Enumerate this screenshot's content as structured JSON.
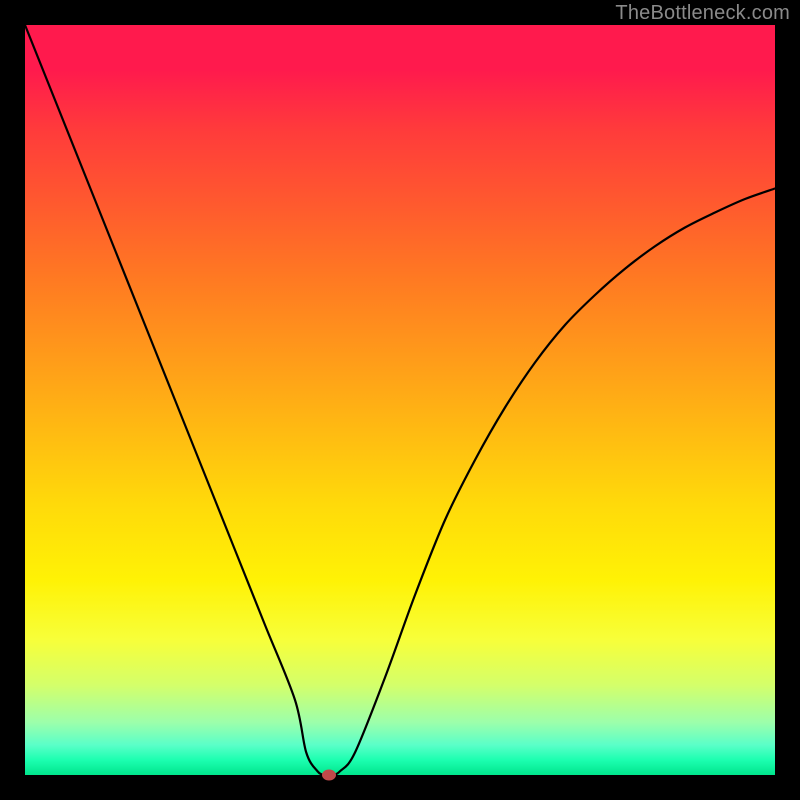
{
  "watermark": "TheBottleneck.com",
  "chart_data": {
    "type": "line",
    "title": "",
    "xlabel": "",
    "ylabel": "",
    "xlim": [
      0,
      100
    ],
    "ylim": [
      0,
      100
    ],
    "series": [
      {
        "name": "curve",
        "x": [
          0,
          4,
          8,
          12,
          16,
          20,
          24,
          28,
          32,
          36,
          37.5,
          39,
          40,
          41,
          42,
          44,
          48,
          52,
          56,
          60,
          64,
          68,
          72,
          76,
          80,
          84,
          88,
          92,
          96,
          100
        ],
        "y": [
          100,
          90,
          80,
          70,
          60,
          50,
          40,
          30,
          20,
          10,
          3,
          0.5,
          0,
          0,
          0.5,
          3,
          13,
          24,
          34,
          42,
          49,
          55,
          60,
          64,
          67.5,
          70.5,
          73,
          75,
          76.8,
          78.2
        ]
      }
    ],
    "marker": {
      "x": 40.5,
      "y": 0
    },
    "gradient_stops": [
      {
        "pct": 0,
        "color": "#ff1a4d"
      },
      {
        "pct": 50,
        "color": "#ffcc00"
      },
      {
        "pct": 95,
        "color": "#7bffb0"
      },
      {
        "pct": 100,
        "color": "#00e58c"
      }
    ]
  }
}
